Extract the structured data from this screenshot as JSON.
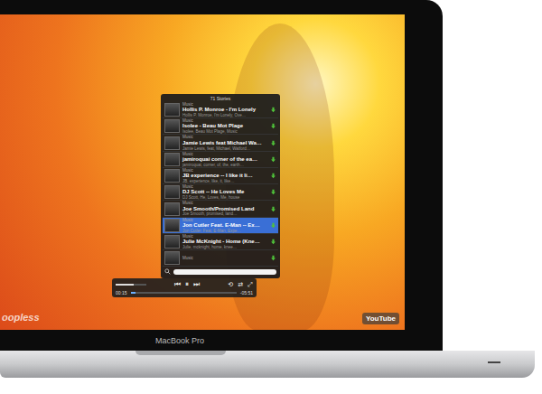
{
  "device": {
    "label": "MacBook Pro"
  },
  "video": {
    "watermark": "oopless",
    "logo": "YouTube"
  },
  "playlist": {
    "header": "71 Stories",
    "items": [
      {
        "category": "Music",
        "title": "Hollis P. Monroe - I'm Lonely",
        "subtitle": "Hollis P. Monroe, I'm Lonely, Ove…",
        "selected": false
      },
      {
        "category": "Music",
        "title": "Isolee - Beau Mot Plage",
        "subtitle": "Isolee, Beau Mot Plage, Music",
        "selected": false
      },
      {
        "category": "Music",
        "title": "Jamie Lewis feat Michael Wa…",
        "subtitle": "Jamie Lewis, feat, Michael, Watford…",
        "selected": false
      },
      {
        "category": "Music",
        "title": "jamiroquai corner of the ea…",
        "subtitle": "jamiroquai, corner, of, the, earth…",
        "selected": false
      },
      {
        "category": "Music",
        "title": "JB experience -- I like it li…",
        "subtitle": "JB, experience, like, it, like…",
        "selected": false
      },
      {
        "category": "Music",
        "title": "DJ Scott -- He Loves Me",
        "subtitle": "DJ Scott, He, Loves, Me, house",
        "selected": false
      },
      {
        "category": "Music",
        "title": "Joe Smooth/Promised Land",
        "subtitle": "Joe Smooth, promised, land…",
        "selected": false
      },
      {
        "category": "Music",
        "title": "Jon Cutler Feat. E-Man -- Ex…",
        "subtitle": "Jon Cutler, Feat, E-Man, Expe…",
        "selected": true
      },
      {
        "category": "Music",
        "title": "Julie McKnight - Home (Kne…",
        "subtitle": "Julie, mcknight, home, knee…",
        "selected": false
      },
      {
        "category": "Music",
        "title": "",
        "subtitle": "",
        "selected": false
      }
    ],
    "search": {
      "placeholder": ""
    }
  },
  "player": {
    "elapsed": "00:15",
    "remaining": "-05:51",
    "level": 0.05,
    "volume": 0.6,
    "buttons": [
      "⏮",
      "⏸",
      "⏭"
    ],
    "extras": [
      "⟲",
      "⇄",
      "⤢"
    ]
  }
}
